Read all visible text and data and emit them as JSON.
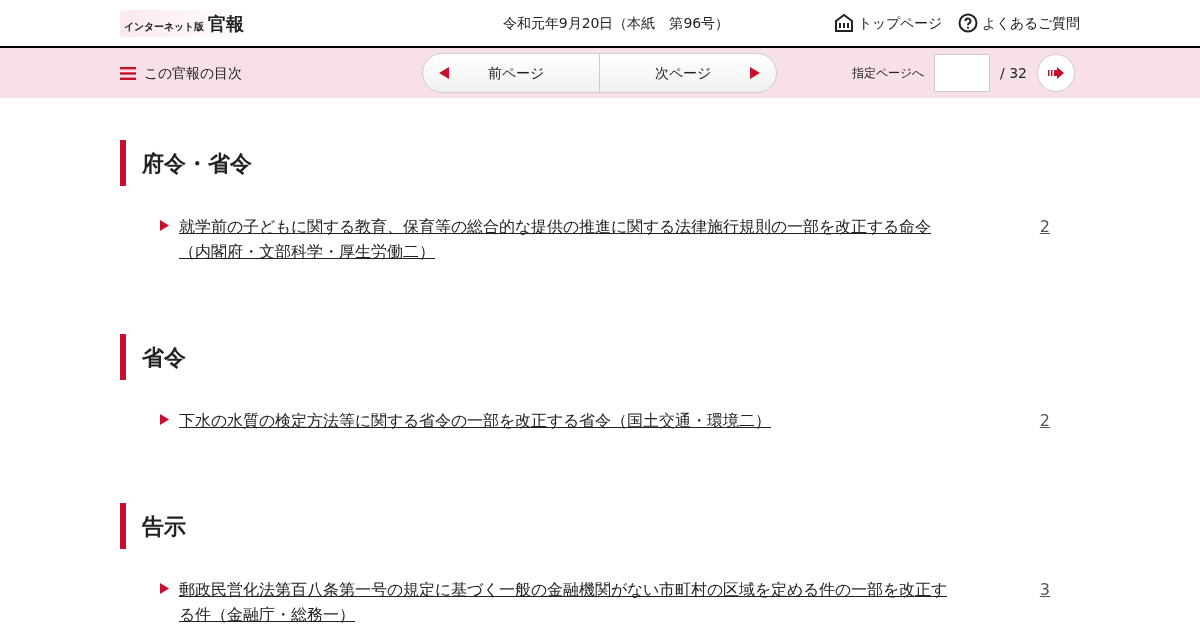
{
  "header": {
    "logo_small": "インターネット版",
    "logo_main": "官報",
    "issue": "令和元年9月20日（本紙　第96号）",
    "links": [
      {
        "kind": "home",
        "label": "トップページ"
      },
      {
        "kind": "help",
        "label": "よくあるご質問"
      }
    ]
  },
  "navbar": {
    "toc": "この官報の目次",
    "prev": "前ページ",
    "next": "次ページ",
    "goto_label": "指定ページへ",
    "total": "/ 32"
  },
  "sections": [
    {
      "title": "府令・省令",
      "items": [
        {
          "text": "就学前の子どもに関する教育、保育等の総合的な提供の推進に関する法律施行規則の一部を改正する命令（内閣府・文部科学・厚生労働二）",
          "page": "2"
        }
      ]
    },
    {
      "title": "省令",
      "items": [
        {
          "text": "下水の水質の検定方法等に関する省令の一部を改正する省令（国土交通・環境二）",
          "page": "2"
        }
      ]
    },
    {
      "title": "告示",
      "items": [
        {
          "text": "郵政民営化法第百八条第一号の規定に基づく一般の金融機関がない市町村の区域を定める件の一部を改正する件（金融庁・総務一）",
          "page": "3"
        }
      ]
    }
  ]
}
